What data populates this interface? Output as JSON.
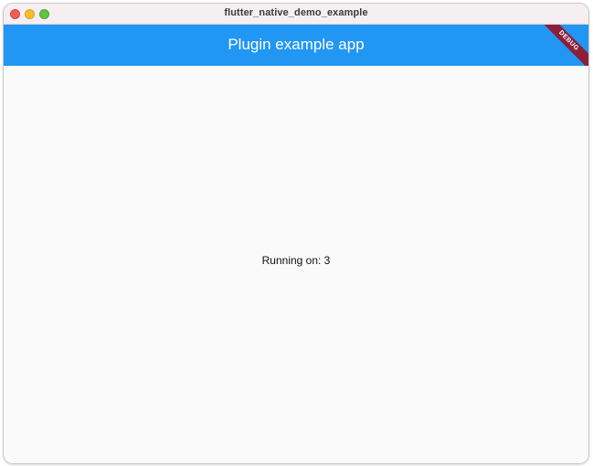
{
  "window": {
    "title": "flutter_native_demo_example",
    "controls": [
      "close",
      "minimize",
      "zoom"
    ]
  },
  "appbar": {
    "title": "Plugin example app",
    "color": "#2196f3"
  },
  "debug_banner": {
    "label": "DEBUG",
    "color": "#8b1f3a"
  },
  "content": {
    "text": "Running on: 3"
  }
}
